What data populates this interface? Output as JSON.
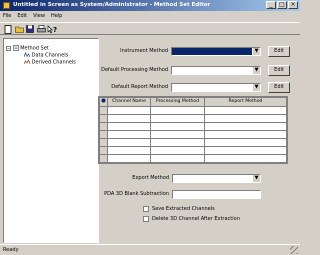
{
  "window": {
    "title": "Untitled in Screen as System/Administrator - Method Set Editor"
  },
  "menu": {
    "items": [
      "File",
      "Edit",
      "View",
      "Help"
    ]
  },
  "tree": {
    "root": "Method Set",
    "children": [
      "Data Channels",
      "Derived Channels"
    ]
  },
  "form": {
    "instrument_method_label": "Instrument Method",
    "instrument_method_value": "",
    "default_processing_label": "Default Processing Method",
    "default_processing_value": "",
    "default_report_label": "Default Report Method",
    "default_report_value": "",
    "edit_label": "Edit",
    "export_method_label": "Export Method",
    "export_method_value": "",
    "pda_label": "PDA 3D Blank Subtraction",
    "pda_value": "",
    "save_extracted_label": "Save Extracted Channels",
    "delete_3d_label": "Delete 3D Channel After Extraction"
  },
  "grid": {
    "columns": [
      "Channel Name",
      "Processing Method",
      "Report Method"
    ],
    "rows": [
      [
        "",
        "",
        ""
      ],
      [
        "",
        "",
        ""
      ],
      [
        "",
        "",
        ""
      ],
      [
        "",
        "",
        ""
      ],
      [
        "",
        "",
        ""
      ],
      [
        "",
        "",
        ""
      ],
      [
        "",
        "",
        ""
      ]
    ]
  },
  "status": {
    "text": "Ready"
  },
  "colors": {
    "selection": "#0a246a",
    "titlebar": "#0a246a"
  }
}
